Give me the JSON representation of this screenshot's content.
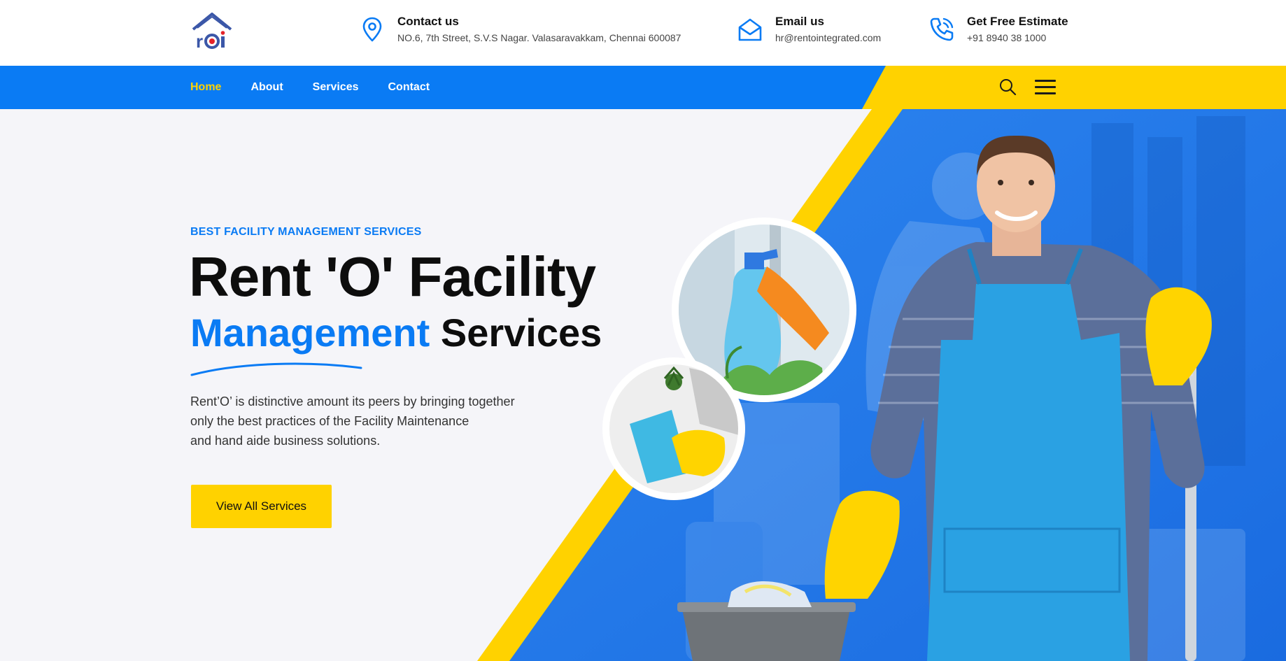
{
  "header": {
    "logo_text": "roi",
    "contacts": [
      {
        "icon": "map-pin-icon",
        "title": "Contact us",
        "text": "NO.6, 7th Street, S.V.S Nagar. Valasaravakkam, Chennai 600087"
      },
      {
        "icon": "envelope-icon",
        "title": "Email us",
        "text": "hr@rentointegrated.com"
      },
      {
        "icon": "phone-icon",
        "title": "Get Free Estimate",
        "text": "+91 8940 38 1000"
      }
    ]
  },
  "nav": {
    "items": [
      {
        "label": "Home",
        "active": true
      },
      {
        "label": "About",
        "active": false
      },
      {
        "label": "Services",
        "active": false
      },
      {
        "label": "Contact",
        "active": false
      }
    ],
    "search_icon": "search-icon",
    "menu_icon": "hamburger-menu-icon"
  },
  "hero": {
    "eyebrow": "BEST FACILITY MANAGEMENT SERVICES",
    "title_line1": "Rent 'O' Facility",
    "title_line2_accent": "Management",
    "title_line2_rest": "Services",
    "description_lines": [
      "Rent’O’ is distinctive amount its peers by bringing together",
      "only the best practices of the Facility Maintenance",
      "and hand aide business solutions."
    ],
    "cta_label": "View All Services"
  },
  "colors": {
    "brand_blue": "#0a7bf4",
    "brand_yellow": "#ffd200",
    "hero_bg": "#f5f5f9",
    "text_dark": "#0d0d0d"
  }
}
